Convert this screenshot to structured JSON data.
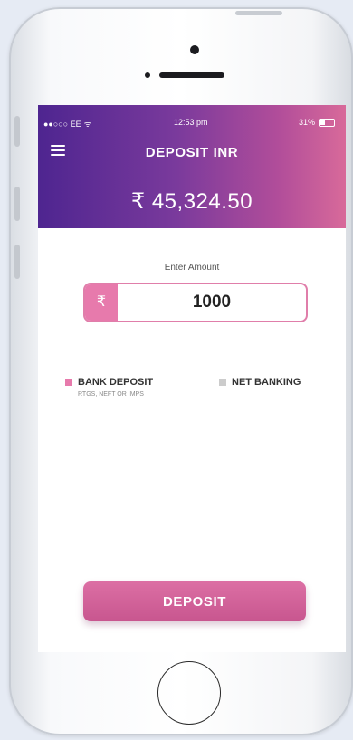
{
  "status_bar": {
    "carrier": "●●○○○ EE",
    "wifi_icon": "wifi-icon",
    "time": "12:53 pm",
    "battery": "31%"
  },
  "header": {
    "title": "DEPOSIT INR",
    "balance": "₹ 45,324.50"
  },
  "amount": {
    "label": "Enter Amount",
    "currency_symbol": "₹",
    "value": "1000"
  },
  "methods": [
    {
      "name": "BANK DEPOSIT",
      "subtitle": "RTGS, NEFT OR IMPS",
      "selected": true,
      "color": "#e77aac"
    },
    {
      "name": "NET BANKING",
      "selected": false,
      "color": "#cccccc"
    }
  ],
  "actions": {
    "deposit_label": "DEPOSIT"
  },
  "colors": {
    "gradient_start": "#4e2590",
    "gradient_end": "#d86a9a",
    "accent": "#e77aac"
  }
}
